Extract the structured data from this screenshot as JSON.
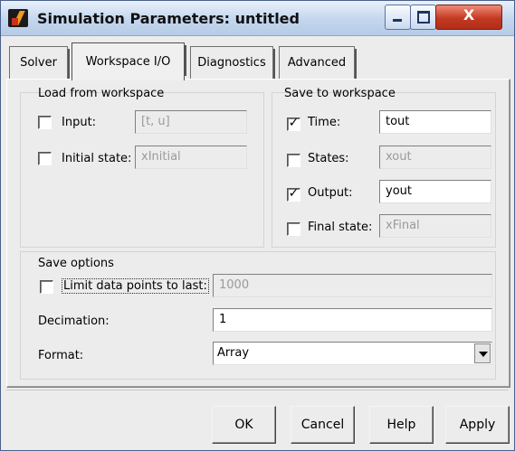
{
  "window": {
    "title": "Simulation Parameters: untitled",
    "close_glyph": "X"
  },
  "tabs": [
    {
      "label": "Solver",
      "active": false
    },
    {
      "label": "Workspace I/O",
      "active": true
    },
    {
      "label": "Diagnostics",
      "active": false
    },
    {
      "label": "Advanced",
      "active": false
    }
  ],
  "load": {
    "title": "Load from workspace",
    "input": {
      "label": "Input:",
      "checked": false,
      "value": "[t, u]"
    },
    "initial_state": {
      "label": "Initial state:",
      "checked": false,
      "value": "xInitial"
    }
  },
  "save": {
    "title": "Save to workspace",
    "time": {
      "label": "Time:",
      "checked": true,
      "value": "tout"
    },
    "states": {
      "label": "States:",
      "checked": false,
      "value": "xout"
    },
    "output": {
      "label": "Output:",
      "checked": true,
      "value": "yout"
    },
    "final_state": {
      "label": "Final state:",
      "checked": false,
      "value": "xFinal"
    }
  },
  "options": {
    "title": "Save options",
    "limit": {
      "label": "Limit data points to last:",
      "checked": false,
      "value": "1000"
    },
    "decimation": {
      "label": "Decimation:",
      "value": "1"
    },
    "format": {
      "label": "Format:",
      "value": "Array"
    }
  },
  "buttons": {
    "ok": "OK",
    "cancel": "Cancel",
    "help": "Help",
    "apply": "Apply"
  },
  "colors": {
    "title_bar": "#c3d6ee",
    "close_button": "#c33a22",
    "dialog_bg": "#ececec"
  },
  "icons": [
    "simulink-app-icon",
    "minimize-icon",
    "maximize-icon",
    "close-icon",
    "chevron-down-icon"
  ]
}
